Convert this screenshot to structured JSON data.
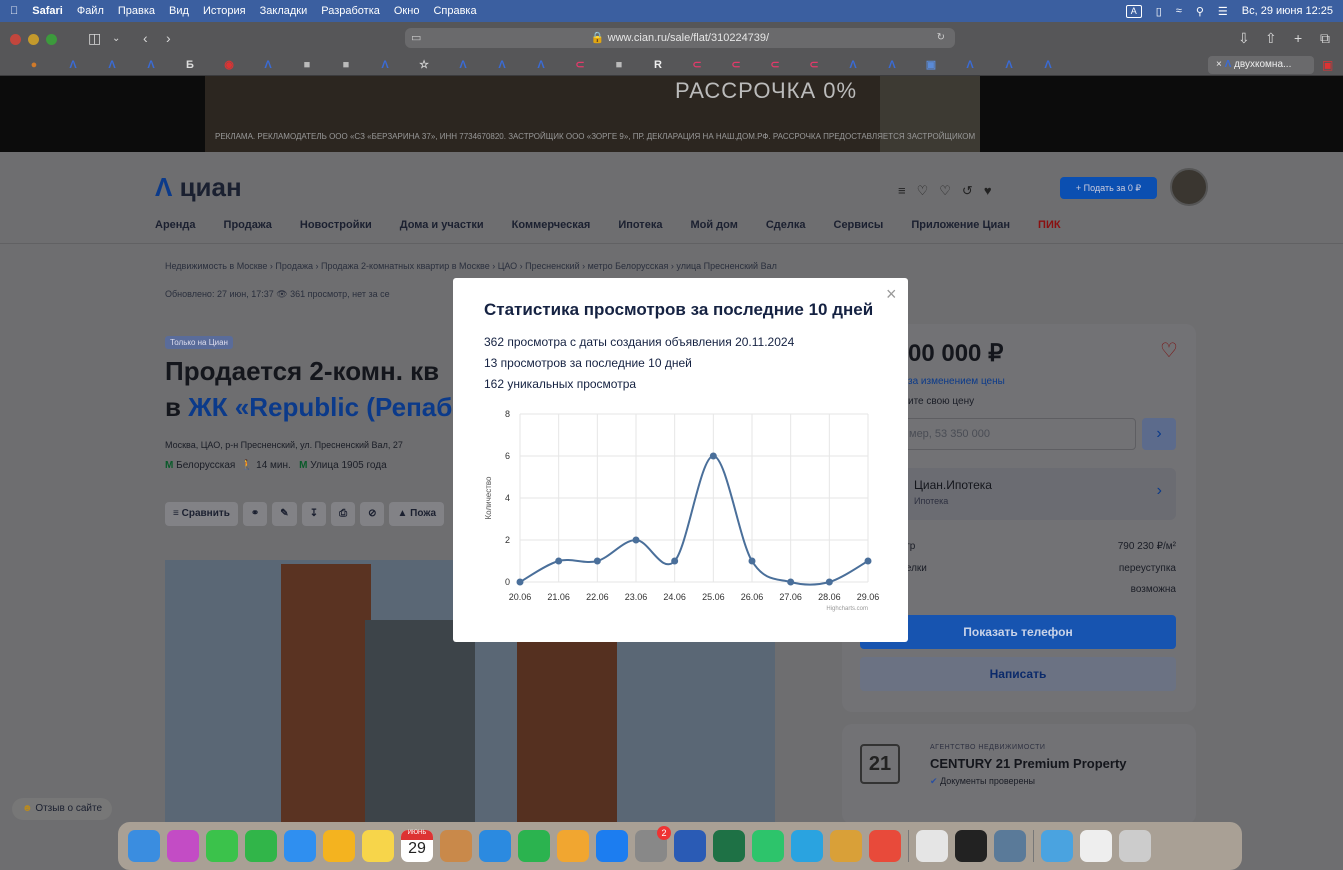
{
  "menubar": {
    "app": "Safari",
    "items": [
      "Файл",
      "Правка",
      "Вид",
      "История",
      "Закладки",
      "Разработка",
      "Окно",
      "Справка"
    ],
    "input_badge": "A",
    "clock": "Вс, 29 июня 12:25"
  },
  "browser": {
    "url": "www.cian.ru/sale/flat/310224739/",
    "active_tab": "двухкомна..."
  },
  "ad": {
    "headline": "РАССРОЧКА 0%",
    "disclaimer": "РЕКЛАМА. РЕКЛАМОДАТЕЛЬ ООО «СЗ «БЕРЗАРИНА 37», ИНН 7734670820. ЗАСТРОЙЩИК ООО «ЗОРГЕ 9», ПР. ДЕКЛАРАЦИЯ НА НАШ.ДОМ.РФ. РАССРОЧКА ПРЕДОСТАВЛЯЕТСЯ ЗАСТРОЙЩИКОМ"
  },
  "site": {
    "logo": "циан",
    "post_button": "+ Подать за 0 ₽",
    "nav": [
      "Аренда",
      "Продажа",
      "Новостройки",
      "Дома и участки",
      "Коммерческая",
      "Ипотека",
      "Мой дом",
      "Сделка",
      "Сервисы",
      "Приложение Циан",
      "ПИК"
    ]
  },
  "listing": {
    "breadcrumb": "Недвижимость в Москве  ›  Продажа  ›  Продажа 2-комнатных квартир в Москве  ›  ЦАО  ›  Пресненский  ›  метро Белорусская  ›  улица Пресненский Вал",
    "updated": "Обновлено: 27 июн, 17:37   👁 361 просмотр, нет за се",
    "only_badge": "Только на Циан",
    "title_line1": "Продается 2-комн. кв",
    "title_line2_prefix": "в ",
    "title_line2_link": "ЖК «Republic (Репаб",
    "address": "Москва, ЦАО, р-н Пресненский, ул. Пресненский Вал, 27",
    "metro1": "Белорусская",
    "metro1_time": "14 мин.",
    "metro2": "Улица 1905 года",
    "actions": [
      "Сравнить",
      "Пожа"
    ]
  },
  "sidebar": {
    "price": "00 000 ₽",
    "follow_price": "за изменением цены",
    "offer_label": "ите свою цену",
    "offer_placeholder": "мер, 53 350 000",
    "mortgage_title": "Циан.Ипотека",
    "mortgage_sub": "Ипотека",
    "rows": [
      {
        "label": "етр",
        "value": "790 230 ₽/м²"
      },
      {
        "label": "делки",
        "value": "переуступка"
      },
      {
        "label": "",
        "value": "возможна"
      }
    ],
    "phone_button": "Показать телефон",
    "write_button": "Написать",
    "agency_type": "АГЕНТСТВО НЕДВИЖИМОСТИ",
    "agency_name": "CENTURY 21 Premium Property",
    "agency_docs": "Документы проверены",
    "agency_logo_text": "21"
  },
  "feedback": "Отзыв о сайте",
  "modal": {
    "title": "Статистика просмотров за последние 10 дней",
    "stats": [
      "362 просмотра с даты создания объявления 20.11.2024",
      "13 просмотров за последние 10 дней",
      "162 уникальных просмотра"
    ],
    "close": "×"
  },
  "chart_data": {
    "type": "line",
    "categories": [
      "20.06",
      "21.06",
      "22.06",
      "23.06",
      "24.06",
      "25.06",
      "26.06",
      "27.06",
      "28.06",
      "29.06"
    ],
    "values": [
      0,
      1,
      1,
      2,
      1,
      6,
      1,
      0,
      0,
      1
    ],
    "ylabel": "Количество",
    "ylim": [
      0,
      8
    ],
    "yticks": [
      0,
      2,
      4,
      6,
      8
    ],
    "credit": "Highcharts.com",
    "grid": true,
    "color": "#4a6f9a"
  },
  "dock": {
    "calendar_month": "ИЮНЬ",
    "calendar_day": "29",
    "badge": "2"
  }
}
